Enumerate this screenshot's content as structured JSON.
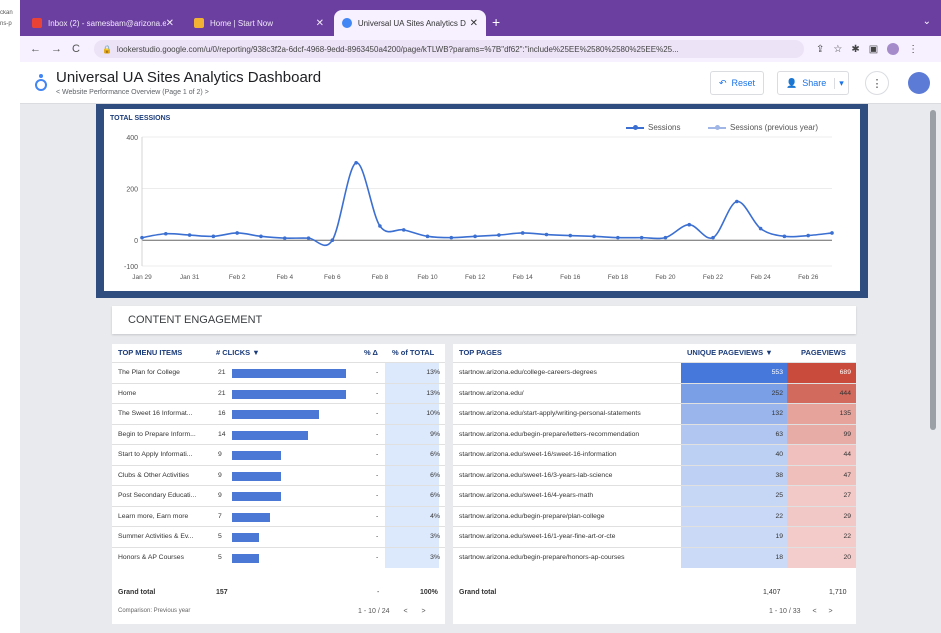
{
  "left_strip": [
    "ckan",
    "ns-p"
  ],
  "browser": {
    "tabs": [
      {
        "title": "Inbox (2) - samesbam@arizona.ed",
        "icon": "gmail-icon",
        "color": "#ea4335"
      },
      {
        "title": "Home | Start Now",
        "icon": "site-icon",
        "color": "#f2b233"
      },
      {
        "title": "Universal UA Sites Analytics D",
        "icon": "looker-icon",
        "color": "#4285f4"
      }
    ],
    "new_tab": "+",
    "url": "lookerstudio.google.com/u/0/reporting/938c3f2a-6dcf-4968-9edd-8963450a4200/page/kTLWB?params=%7B\"df62\":\"include%25EE%2580%2580%25EE%25..."
  },
  "header": {
    "title": "Universal UA Sites Analytics Dashboard",
    "subtitle": "Website Performance Overview (Page 1 of 2)",
    "reset_label": "Reset",
    "share_label": "Share"
  },
  "sessions_chart": {
    "title": "TOTAL SESSIONS",
    "legend_current": "Sessions",
    "legend_previous": "Sessions (previous year)",
    "colors": {
      "current": "#3b6fd1",
      "previous": "#9fb6e6",
      "axis": "#666666"
    }
  },
  "chart_data": {
    "type": "line",
    "x": [
      "Jan 29",
      "Jan 30",
      "Jan 31",
      "Feb 1",
      "Feb 2",
      "Feb 3",
      "Feb 4",
      "Feb 5",
      "Feb 6",
      "Feb 7",
      "Feb 8",
      "Feb 9",
      "Feb 10",
      "Feb 11",
      "Feb 12",
      "Feb 13",
      "Feb 14",
      "Feb 15",
      "Feb 16",
      "Feb 17",
      "Feb 18",
      "Feb 19",
      "Feb 20",
      "Feb 21",
      "Feb 22",
      "Feb 23",
      "Feb 24",
      "Feb 25",
      "Feb 26",
      "Feb 27"
    ],
    "xticks": [
      "Jan 29",
      "Jan 31",
      "Feb 2",
      "Feb 4",
      "Feb 6",
      "Feb 8",
      "Feb 10",
      "Feb 12",
      "Feb 14",
      "Feb 16",
      "Feb 18",
      "Feb 20",
      "Feb 22",
      "Feb 24",
      "Feb 26"
    ],
    "series": [
      {
        "name": "Sessions",
        "values": [
          10,
          25,
          20,
          15,
          28,
          15,
          8,
          8,
          0,
          300,
          55,
          40,
          15,
          10,
          15,
          20,
          28,
          22,
          18,
          15,
          10,
          10,
          10,
          60,
          10,
          150,
          45,
          15,
          18,
          28
        ]
      }
    ],
    "ylim": [
      -100,
      400
    ],
    "yticks": [
      400,
      200,
      0,
      -100
    ],
    "grid": "horizontal"
  },
  "content_engagement": {
    "title": "CONTENT ENGAGEMENT"
  },
  "menu_table": {
    "headers": [
      "TOP MENU ITEMS",
      "# CLICKS ▼",
      "% Δ",
      "% of TOTAL"
    ],
    "rows": [
      {
        "item": "The Plan for College",
        "clicks": 21,
        "delta": "-",
        "pct": "13%"
      },
      {
        "item": "Home",
        "clicks": 21,
        "delta": "-",
        "pct": "13%"
      },
      {
        "item": "The Sweet 16 Informat...",
        "clicks": 16,
        "delta": "-",
        "pct": "10%"
      },
      {
        "item": "Begin to Prepare Inform...",
        "clicks": 14,
        "delta": "-",
        "pct": "9%"
      },
      {
        "item": "Start to Apply Informati...",
        "clicks": 9,
        "delta": "-",
        "pct": "6%"
      },
      {
        "item": "Clubs & Other Activities",
        "clicks": 9,
        "delta": "-",
        "pct": "6%"
      },
      {
        "item": "Post Secondary Educati...",
        "clicks": 9,
        "delta": "-",
        "pct": "6%"
      },
      {
        "item": "Learn more, Earn more",
        "clicks": 7,
        "delta": "-",
        "pct": "4%"
      },
      {
        "item": "Summer Activities & Ev...",
        "clicks": 5,
        "delta": "-",
        "pct": "3%"
      },
      {
        "item": "Honors & AP Courses",
        "clicks": 5,
        "delta": "-",
        "pct": "3%"
      }
    ],
    "grand_total_label": "Grand total",
    "grand_total": "157",
    "grand_delta": "-",
    "grand_pct": "100%",
    "comparison": "Comparison: Previous year",
    "pager": "1 - 10 / 24"
  },
  "pages_table": {
    "headers": [
      "TOP PAGES",
      "UNIQUE PAGEVIEWS ▼",
      "PAGEVIEWS"
    ],
    "rows": [
      {
        "page": "startnow.arizona.edu/college-careers-degrees",
        "unique": "553",
        "views": "689"
      },
      {
        "page": "startnow.arizona.edu/",
        "unique": "252",
        "views": "444"
      },
      {
        "page": "startnow.arizona.edu/start-apply/writing-personal-statements",
        "unique": "132",
        "views": "135"
      },
      {
        "page": "startnow.arizona.edu/begin-prepare/letters-recommendation",
        "unique": "63",
        "views": "99"
      },
      {
        "page": "startnow.arizona.edu/sweet-16/sweet-16-information",
        "unique": "40",
        "views": "44"
      },
      {
        "page": "startnow.arizona.edu/sweet-16/3-years-lab-science",
        "unique": "38",
        "views": "47"
      },
      {
        "page": "startnow.arizona.edu/sweet-16/4-years-math",
        "unique": "25",
        "views": "27"
      },
      {
        "page": "startnow.arizona.edu/begin-prepare/plan-college",
        "unique": "22",
        "views": "29"
      },
      {
        "page": "startnow.arizona.edu/sweet-16/1-year-fine-art-or-cte",
        "unique": "19",
        "views": "22"
      },
      {
        "page": "startnow.arizona.edu/begin-prepare/honors-ap-courses",
        "unique": "18",
        "views": "20"
      }
    ],
    "unique_values": [
      553,
      252,
      132,
      63,
      40,
      38,
      25,
      22,
      19,
      18
    ],
    "views_values": [
      689,
      444,
      135,
      99,
      44,
      47,
      27,
      29,
      22,
      20
    ],
    "grand_total_label": "Grand total",
    "grand_unique": "1,407",
    "grand_views": "1,710",
    "pager": "1 - 10 / 33"
  }
}
